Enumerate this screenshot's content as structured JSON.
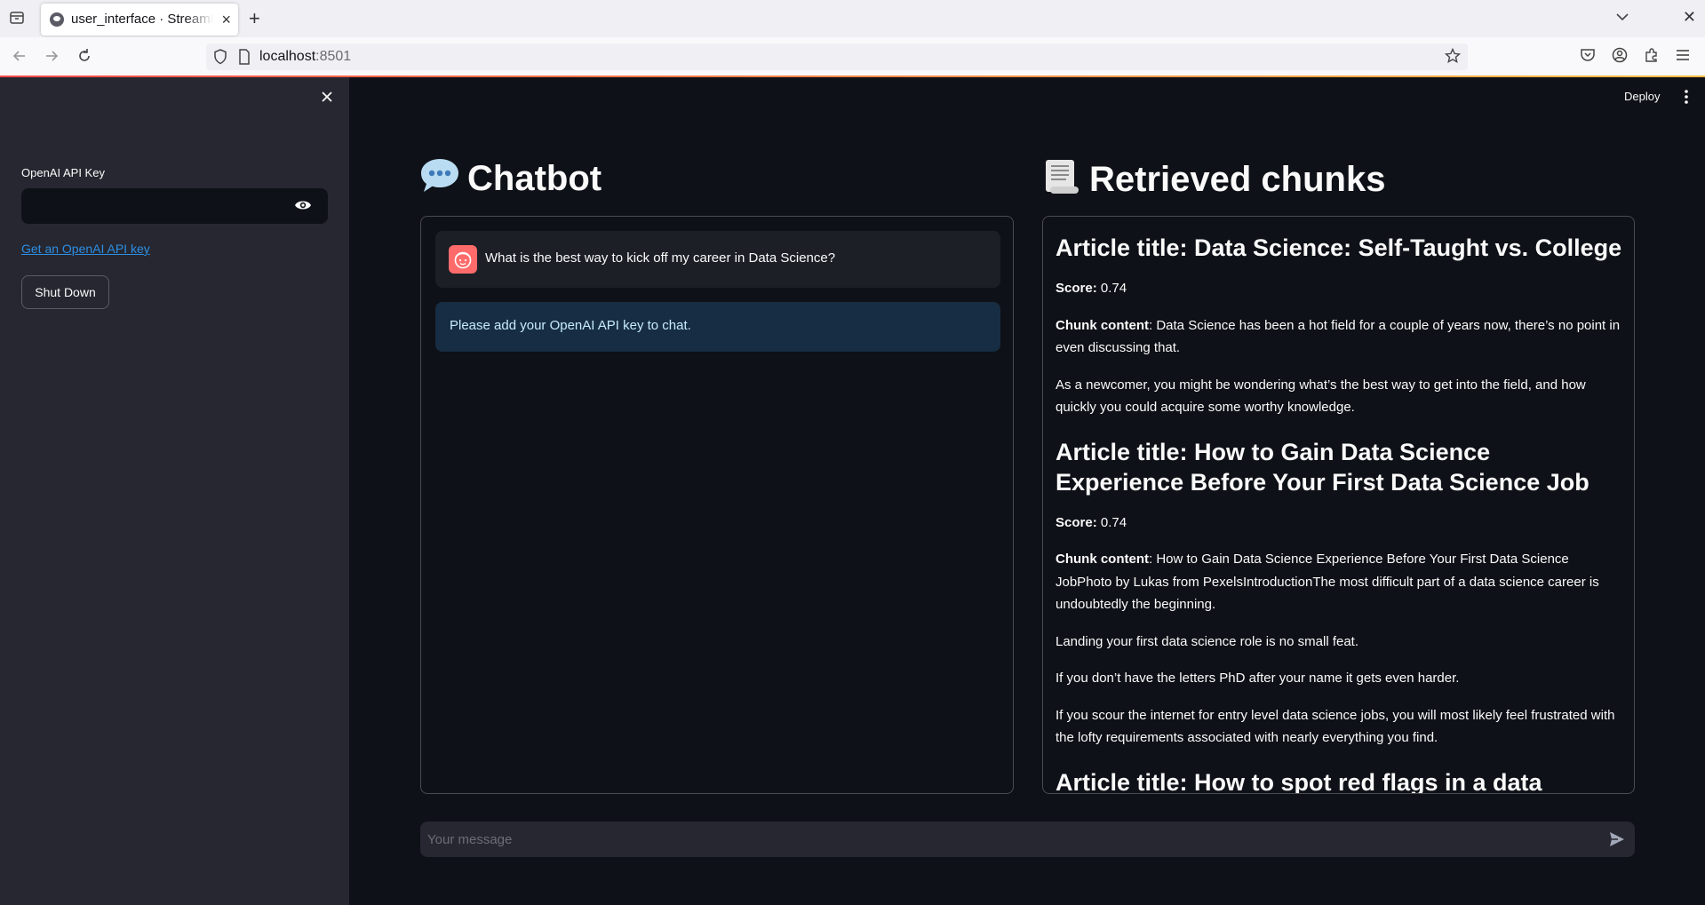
{
  "browser": {
    "tab_title": "user_interface · Streamlit",
    "url_host": "localhost",
    "url_port": ":8501"
  },
  "sidebar": {
    "api_key_label": "OpenAI API Key",
    "api_key_value": "",
    "api_link_label": "Get an OpenAI API key",
    "shutdown_label": "Shut Down"
  },
  "header": {
    "deploy_label": "Deploy"
  },
  "chat": {
    "title": "Chatbot",
    "title_icon": "speech-balloon-icon",
    "user_message": "What is the best way to kick off my career in Data Science?",
    "info_message": "Please add your OpenAI API key to chat.",
    "input_placeholder": "Your message"
  },
  "chunks": {
    "title": "Retrieved chunks",
    "title_icon": "scroll-icon",
    "score_label": "Score:",
    "content_label": "Chunk content",
    "items": [
      {
        "heading": "Article title: Data Science: Self-Taught vs. College",
        "score": "0.74",
        "content_first": "Data Science has been a hot field for a couple of years now, there’s no point in even discussing that.",
        "paragraphs": [
          "As a newcomer, you might be wondering what’s the best way to get into the field, and how quickly you could acquire some worthy knowledge."
        ]
      },
      {
        "heading": "Article title: How to Gain Data Science Experience Before Your First Data Science Job",
        "score": "0.74",
        "content_first": "How to Gain Data Science Experience Before Your First Data Science JobPhoto by Lukas from PexelsIntroductionThe most difficult part of a data science career is undoubtedly the beginning.",
        "paragraphs": [
          "Landing your first data science role is no small feat.",
          "If you don’t have the letters PhD after your name it gets even harder.",
          "If you scour the internet for entry level data science jobs, you will most likely feel frustrated with the lofty requirements associated with nearly everything you find."
        ]
      },
      {
        "heading": "Article title: How to spot red flags in a data science",
        "score": "",
        "content_first": "",
        "paragraphs": []
      }
    ]
  },
  "colors": {
    "background": "#0e1117",
    "sidebar": "#262730",
    "accent": "#ff4b4b",
    "link": "#2c8ee4",
    "info_bg": "#172d43"
  }
}
